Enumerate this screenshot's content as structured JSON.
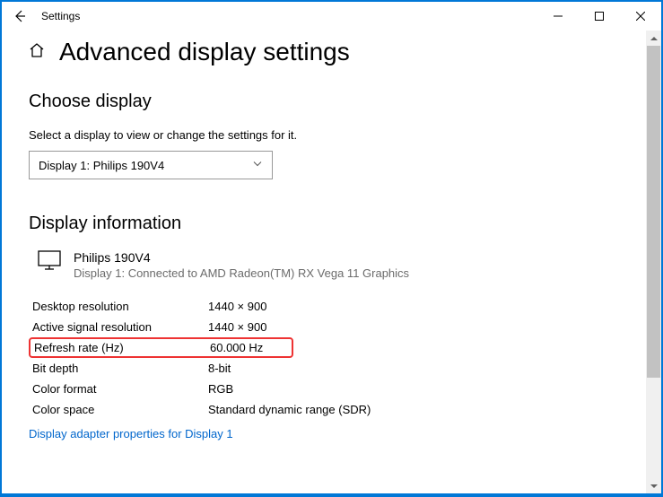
{
  "window": {
    "title": "Settings"
  },
  "page": {
    "title": "Advanced display settings"
  },
  "choose": {
    "heading": "Choose display",
    "subtext": "Select a display to view or change the settings for it.",
    "selected": "Display 1: Philips 190V4"
  },
  "info": {
    "heading": "Display information",
    "display_name": "Philips 190V4",
    "display_sub": "Display 1: Connected to AMD Radeon(TM) RX Vega 11 Graphics",
    "rows": [
      {
        "label": "Desktop resolution",
        "value": "1440 × 900"
      },
      {
        "label": "Active signal resolution",
        "value": "1440 × 900"
      },
      {
        "label": "Refresh rate (Hz)",
        "value": "60.000 Hz"
      },
      {
        "label": "Bit depth",
        "value": "8-bit"
      },
      {
        "label": "Color format",
        "value": "RGB"
      },
      {
        "label": "Color space",
        "value": "Standard dynamic range (SDR)"
      }
    ],
    "link": "Display adapter properties for Display 1"
  }
}
